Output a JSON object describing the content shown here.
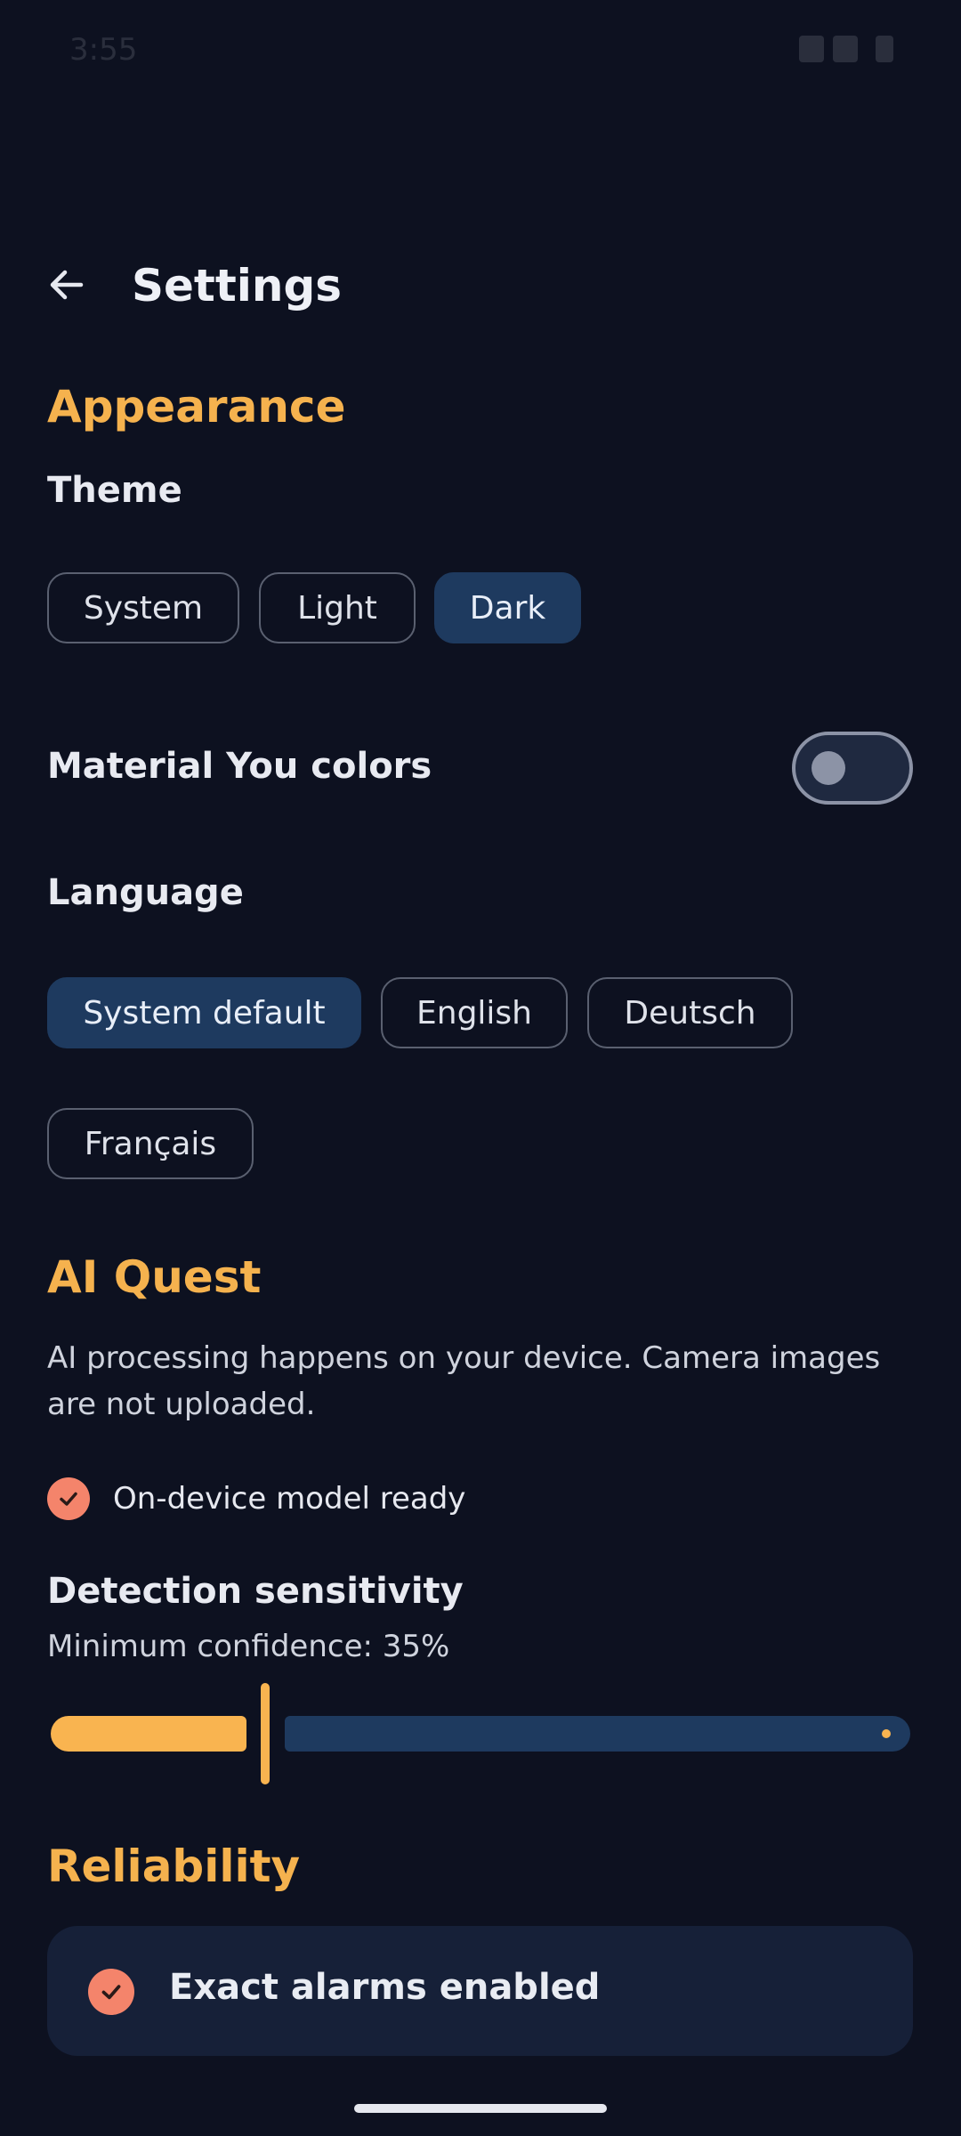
{
  "status_bar": {
    "time": "3:55"
  },
  "header": {
    "title": "Settings",
    "back_icon": "arrow-left-icon"
  },
  "appearance": {
    "section_title": "Appearance",
    "theme_label": "Theme",
    "theme_options": [
      "System",
      "Light",
      "Dark"
    ],
    "theme_selected": "Dark",
    "material_you_label": "Material You colors",
    "material_you_enabled": false,
    "language_label": "Language",
    "language_options": [
      "System default",
      "English",
      "Deutsch",
      "Français"
    ],
    "language_selected": "System default"
  },
  "ai_quest": {
    "section_title": "AI Quest",
    "description": "AI processing happens on your device. Camera images are not uploaded.",
    "model_status": "On-device model ready",
    "sensitivity_label": "Detection sensitivity",
    "confidence_text": "Minimum confidence: 35%",
    "confidence_value": 35
  },
  "reliability": {
    "section_title": "Reliability",
    "exact_alarms_text": "Exact alarms enabled"
  },
  "colors": {
    "background": "#0d1120",
    "accent": "#f5b24e",
    "selected_chip": "#1e3a5f",
    "check": "#f4846b"
  }
}
